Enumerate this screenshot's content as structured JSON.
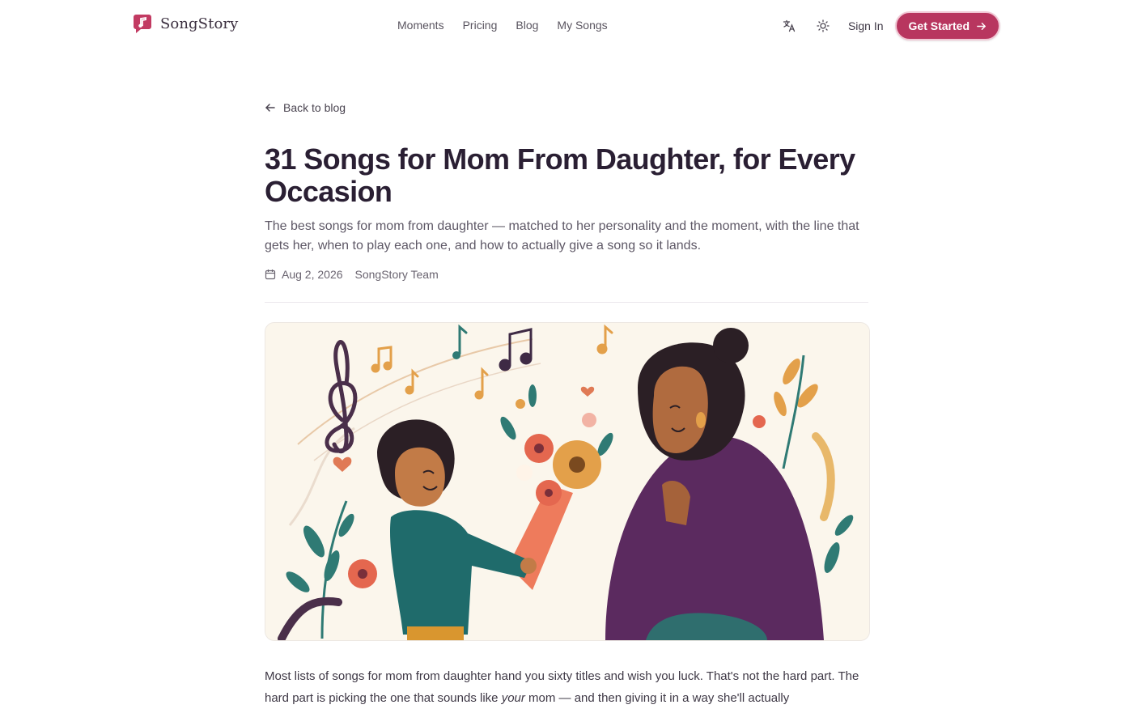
{
  "brand": {
    "name": "SongStory",
    "color": "#b8365f"
  },
  "nav": {
    "items": [
      {
        "label": "Moments"
      },
      {
        "label": "Pricing"
      },
      {
        "label": "Blog"
      },
      {
        "label": "My Songs"
      }
    ]
  },
  "header": {
    "translate_icon": "translate-icon",
    "theme_icon": "sun-icon",
    "sign_in": "Sign In",
    "cta": "Get Started"
  },
  "article": {
    "back_label": "Back to blog",
    "title": "31 Songs for Mom From Daughter, for Every Occasion",
    "subtitle": "The best songs for mom from daughter — matched to her personality and the moment, with the line that gets her, when to play each one, and how to actually give a song so it lands.",
    "date": "Aug 2, 2026",
    "author": "SongStory Team",
    "body_part1": "Most lists of songs for mom from daughter hand you sixty titles and wish you luck. That's not the hard part. The hard part is picking the one that sounds like ",
    "body_em": "your",
    "body_part2": " mom — and then giving it in a way she'll actually"
  }
}
